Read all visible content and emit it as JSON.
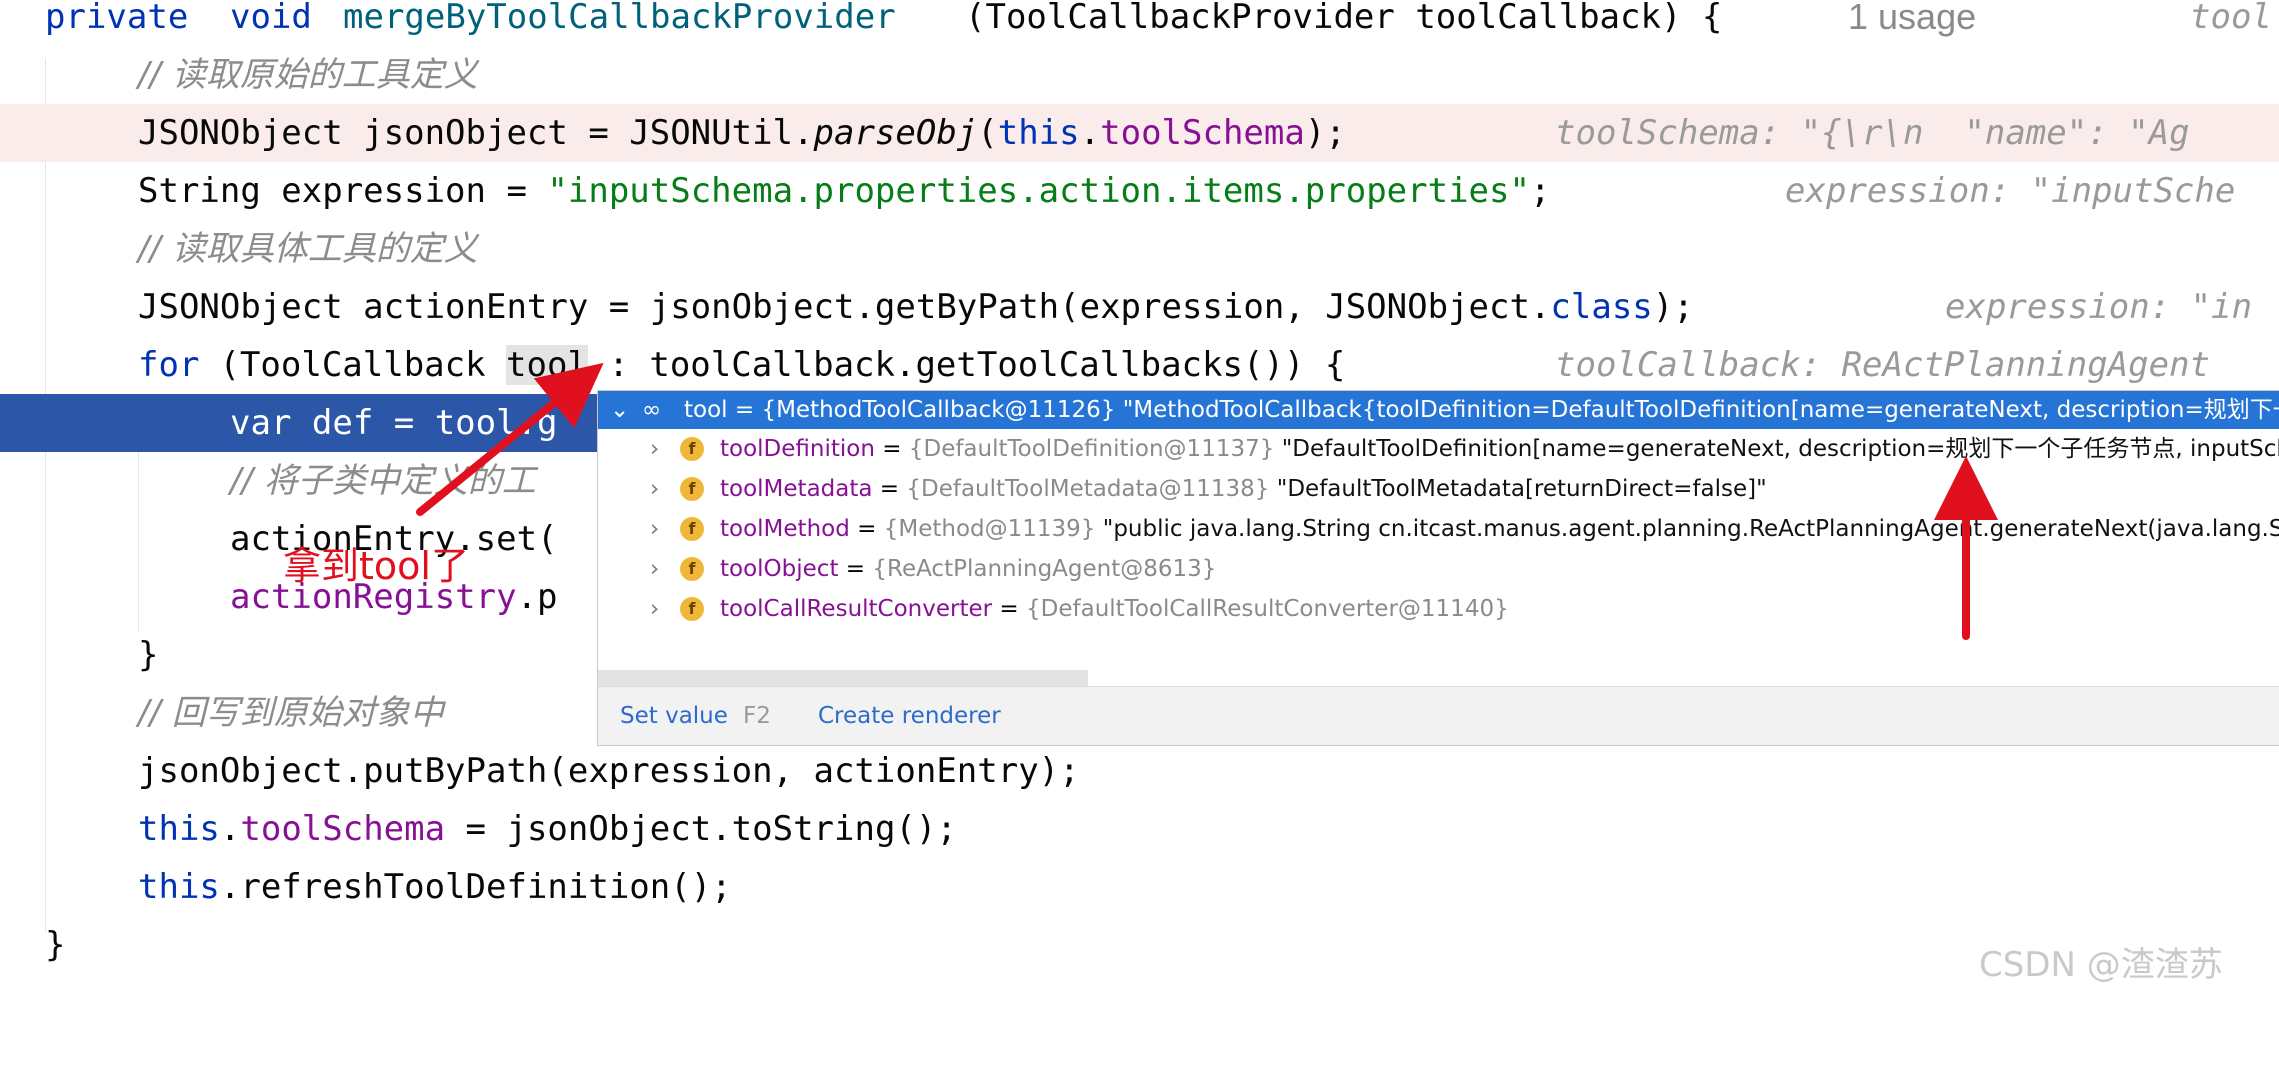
{
  "editor": {
    "usage_hint": "1 usage",
    "right_hint": "tool",
    "lines": {
      "l1": {
        "kw1": "private",
        "kw2": "void",
        "fn": "mergeByToolCallbackProvider",
        "rest": "(ToolCallbackProvider toolCallback) {"
      },
      "l2": {
        "comment": "// 读取原始的工具定义"
      },
      "l3": {
        "a": "JSONObject jsonObject = JSONUtil.",
        "method": "parseObj",
        "b": "(",
        "kw": "this",
        "c": ".",
        "field": "toolSchema",
        "d": ");",
        "hint": "toolSchema: \"{\\r\\n  \"name\": \"Ag"
      },
      "l4": {
        "a": "String expression = ",
        "str": "\"inputSchema.properties.action.items.properties\"",
        "b": ";",
        "hint": "expression: \"inputSche"
      },
      "l5": {
        "comment": "// 读取具体工具的定义"
      },
      "l6": {
        "a": "JSONObject actionEntry = jsonObject.getByPath(expression, JSONObject.",
        "kw": "class",
        "b": ");",
        "hint": "expression: \"in"
      },
      "l7": {
        "kw": "for",
        "a": " (ToolCallback ",
        "var": "tool",
        "b": " : toolCallback.getToolCallbacks()) {",
        "hint": "toolCallback: ReActPlanningAgent"
      },
      "l8": {
        "text": "var def = tool.g"
      },
      "l9": {
        "comment": "// 将子类中定义的工"
      },
      "l10": {
        "text": "actionEntry.set("
      },
      "l11": {
        "field": "actionRegistry",
        "b": ".p"
      },
      "l12": {
        "text": "}"
      },
      "l13": {
        "comment": "// 回写到原始对象中"
      },
      "l14": {
        "text": "jsonObject.putByPath(expression, actionEntry);"
      },
      "l15": {
        "kw": "this",
        "a": ".",
        "field": "toolSchema",
        "b": " = jsonObject.toString();"
      },
      "l16": {
        "kw": "this",
        "a": ".refreshToolDefinition();"
      },
      "l17": {
        "text": "}"
      }
    }
  },
  "debug_popup": {
    "header": "tool = {MethodToolCallback@11126} \"MethodToolCallback{toolDefinition=DefaultToolDefinition[name=generateNext, description=规划下一",
    "rows": [
      {
        "name": "toolDefinition",
        "ref": "{DefaultToolDefinition@11137}",
        "value": "\"DefaultToolDefinition[name=generateNext, description=规划下一个子任务节点, inputSch"
      },
      {
        "name": "toolMetadata",
        "ref": "{DefaultToolMetadata@11138}",
        "value": "\"DefaultToolMetadata[returnDirect=false]\""
      },
      {
        "name": "toolMethod",
        "ref": "{Method@11139}",
        "value": "\"public java.lang.String cn.itcast.manus.agent.planning.ReActPlanningAgent.generateNext(java.lang.Strin"
      },
      {
        "name": "toolObject",
        "ref": "{ReActPlanningAgent@8613}",
        "value": ""
      },
      {
        "name": "toolCallResultConverter",
        "ref": "{DefaultToolCallResultConverter@11140}",
        "value": ""
      }
    ],
    "footer": {
      "set_value": "Set value",
      "set_value_key": "F2",
      "create_renderer": "Create renderer"
    }
  },
  "annotation": {
    "text": "拿到tool了",
    "color": "#e0101f"
  },
  "watermark": "CSDN @渣渣苏",
  "colors": {
    "keyword": "#0033b3",
    "field": "#871094",
    "string": "#067d17",
    "exec_line": "#2c57a8",
    "popup_header": "#2675d6"
  }
}
